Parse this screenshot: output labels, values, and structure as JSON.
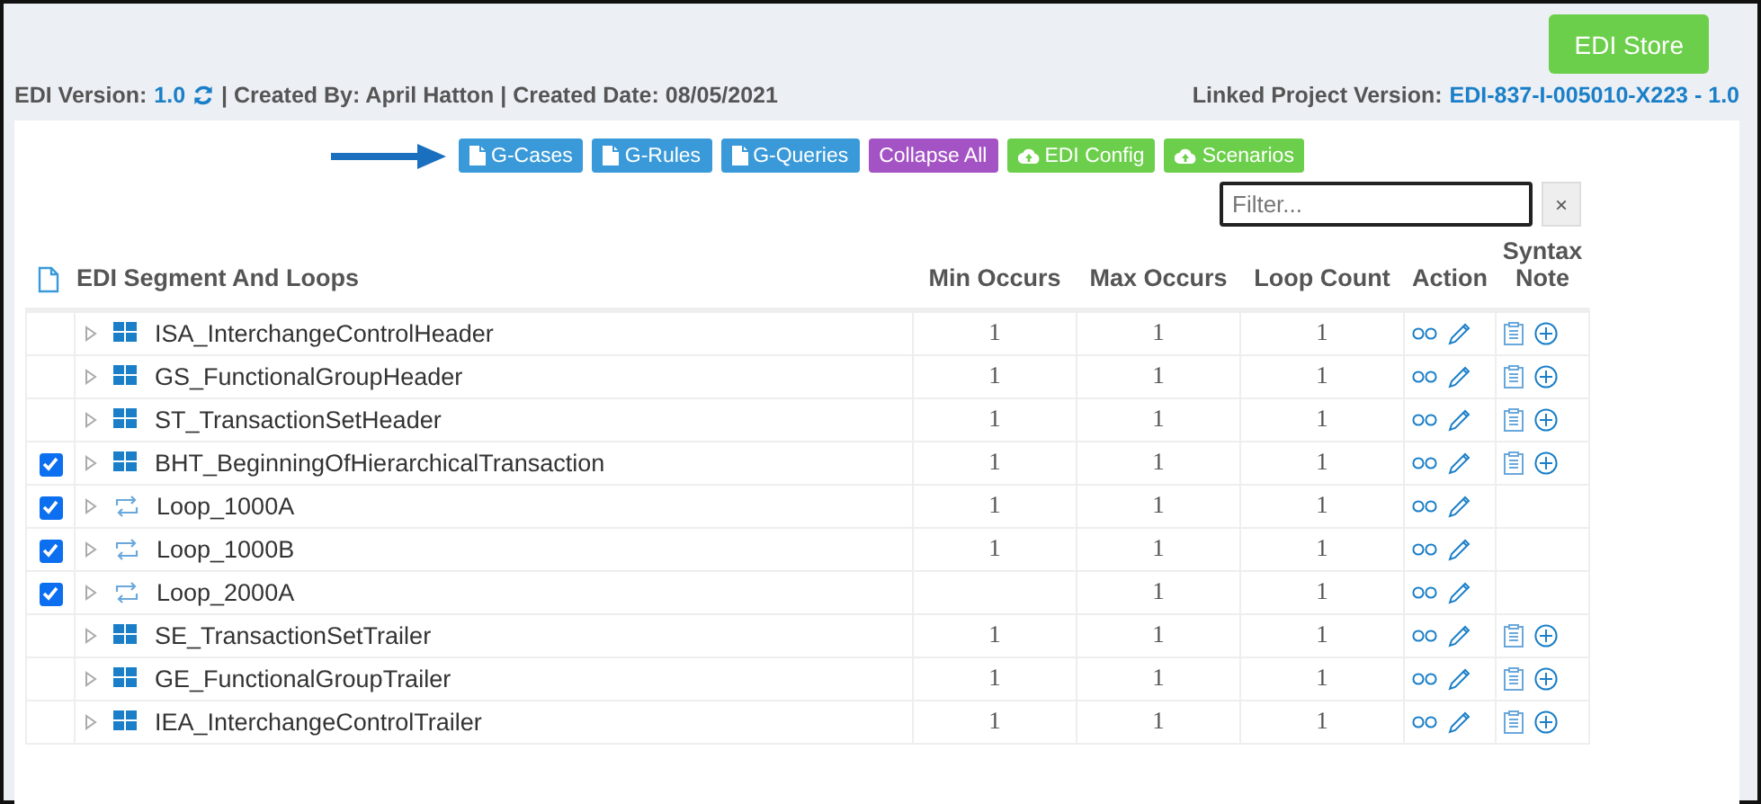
{
  "store_button": "EDI Store",
  "info": {
    "version_label": "EDI Version:",
    "version": "1.0",
    "created_by": "| Created By: April Hatton | Created Date: 08/05/2021",
    "linked_label": "Linked Project Version:",
    "linked_version": "EDI-837-I-005010-X223 - 1.0"
  },
  "toolbar": [
    {
      "label": "G-Cases",
      "kind": "doc",
      "color": "#3a9ad9"
    },
    {
      "label": "G-Rules",
      "kind": "doc",
      "color": "#3a9ad9"
    },
    {
      "label": "G-Queries",
      "kind": "doc",
      "color": "#3a9ad9"
    },
    {
      "label": "Collapse All",
      "kind": "plain",
      "color": "#a453c4"
    },
    {
      "label": "EDI Config",
      "kind": "cloud",
      "color": "#6ccf4b"
    },
    {
      "label": "Scenarios",
      "kind": "cloud",
      "color": "#6ccf4b"
    }
  ],
  "filter": {
    "placeholder": "Filter...",
    "clear": "×"
  },
  "table": {
    "columns": [
      "EDI Segment And Loops",
      "Min Occurs",
      "Max Occurs",
      "Loop Count",
      "Action",
      "Syntax Note"
    ],
    "rows": [
      {
        "name": "ISA_InterchangeControlHeader",
        "kind": "segment",
        "checked": false,
        "min": "1",
        "max": "1",
        "loop": "1",
        "note": true
      },
      {
        "name": "GS_FunctionalGroupHeader",
        "kind": "segment",
        "checked": false,
        "min": "1",
        "max": "1",
        "loop": "1",
        "note": true
      },
      {
        "name": "ST_TransactionSetHeader",
        "kind": "segment",
        "checked": false,
        "min": "1",
        "max": "1",
        "loop": "1",
        "note": true
      },
      {
        "name": "BHT_BeginningOfHierarchicalTransaction",
        "kind": "segment",
        "checked": true,
        "min": "1",
        "max": "1",
        "loop": "1",
        "note": true
      },
      {
        "name": "Loop_1000A",
        "kind": "loop",
        "checked": true,
        "min": "1",
        "max": "1",
        "loop": "1",
        "note": false
      },
      {
        "name": "Loop_1000B",
        "kind": "loop",
        "checked": true,
        "min": "1",
        "max": "1",
        "loop": "1",
        "note": false
      },
      {
        "name": "Loop_2000A",
        "kind": "loop",
        "checked": true,
        "max": "1",
        "loop": "1",
        "note": false
      },
      {
        "name": "SE_TransactionSetTrailer",
        "kind": "segment",
        "checked": false,
        "min": "1",
        "max": "1",
        "loop": "1",
        "note": true
      },
      {
        "name": "GE_FunctionalGroupTrailer",
        "kind": "segment",
        "checked": false,
        "min": "1",
        "max": "1",
        "loop": "1",
        "note": true
      },
      {
        "name": "IEA_InterchangeControlTrailer",
        "kind": "segment",
        "checked": false,
        "min": "1",
        "max": "1",
        "loop": "1",
        "note": true
      }
    ]
  }
}
